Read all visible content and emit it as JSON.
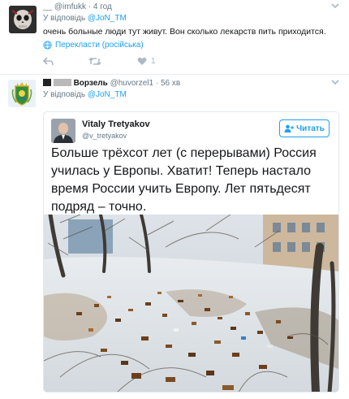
{
  "tweet1": {
    "name": "__",
    "handle": "@imfukk",
    "separator": "·",
    "time": "4 год",
    "reply_prefix": "У відповідь",
    "reply_mention": "@JoN_TM",
    "text": "очень больные люди тут живут. Вон сколько лекарств пить приходится.",
    "translate": "Перекласти (російська)",
    "like_count": "1",
    "icons": [
      "reply-icon",
      "retweet-icon",
      "like-icon",
      "caret-down-icon",
      "globe-icon"
    ]
  },
  "tweet2": {
    "name": "Ворзель",
    "handle": "@huvorzel1",
    "separator": "·",
    "time": "56 хв",
    "reply_prefix": "У відповідь",
    "reply_mention": "@JoN_TM",
    "quote": {
      "name": "Vitaly Tretyakov",
      "handle": "@v_tretyakov",
      "follow_label": "Читать",
      "text": "Больше трёхсот лет (с перерывами) Россия училась у Европы. Хватит! Теперь настало время России учить Европу. Лет пятьдесят подряд – точно."
    }
  },
  "colors": {
    "accent": "#1da1f2",
    "muted": "#657786",
    "icon": "#aab8c2"
  }
}
